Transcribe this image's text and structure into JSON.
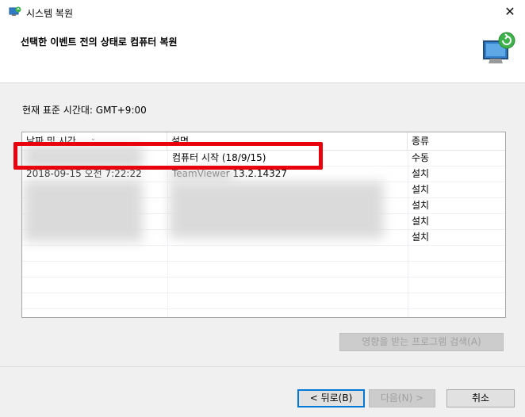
{
  "window": {
    "title": "시스템 복원",
    "close_glyph": "✕",
    "heading": "선택한 이벤트 전의 상태로 컴퓨터 복원"
  },
  "timezone_label": "현재 표준 시간대: GMT+9:00",
  "table": {
    "columns": [
      "날짜 및 시간",
      "설명",
      "종류"
    ],
    "rows": [
      {
        "date": "",
        "description": "컴퓨터 시작 (18/9/15)",
        "type": "수동"
      },
      {
        "date": "2018-09-15 오전 7:22:22",
        "description": "TeamViewer 13.2.14327",
        "type": "설치"
      },
      {
        "date": "",
        "description": "",
        "type": "설치"
      },
      {
        "date": "",
        "description": "",
        "type": "설치"
      },
      {
        "date": "",
        "description": "",
        "type": "설치"
      },
      {
        "date": "",
        "description": "",
        "type": "설치"
      }
    ]
  },
  "buttons": {
    "scan": "영향을 받는 프로그램 검색(A)",
    "back": "< 뒤로(B)",
    "next": "다음(N) >",
    "cancel": "취소"
  },
  "colors": {
    "highlight": "#e8000d",
    "accent": "#0078d7"
  },
  "icons": {
    "app": "system-restore-icon",
    "header": "system-restore-large-icon"
  }
}
